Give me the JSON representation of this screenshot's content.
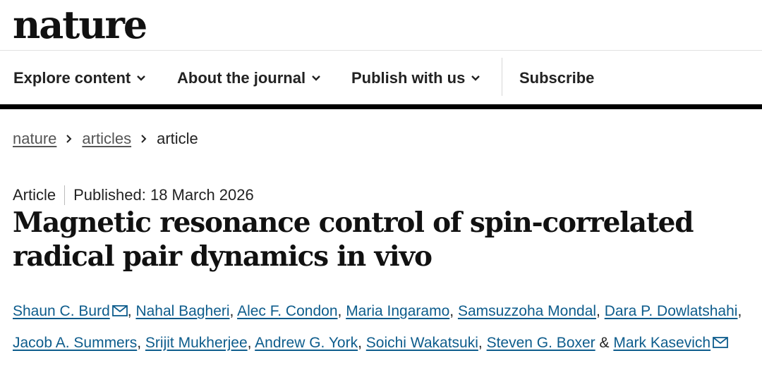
{
  "header": {
    "logo": "nature"
  },
  "nav": {
    "items": [
      {
        "label": "Explore content"
      },
      {
        "label": "About the journal"
      },
      {
        "label": "Publish with us"
      }
    ],
    "subscribe": "Subscribe"
  },
  "breadcrumb": [
    "nature",
    "articles",
    "article"
  ],
  "article": {
    "type": "Article",
    "published": "Published: 18 March 2026",
    "title": "Magnetic resonance control of spin-correlated radical pair dynamics in vivo",
    "authors": [
      "Shaun C. Burd",
      "Nahal Bagheri",
      "Alec F. Condon",
      "Maria Ingaramo",
      "Samsuzzoha Mondal",
      "Dara P. Dowlatshahi",
      "Jacob A. Summers",
      "Srijit Mukherjee",
      "Andrew G. York",
      "Soichi Wakatsuki",
      "Steven G. Boxer",
      "Mark Kasevich"
    ],
    "separator": ",",
    "ampersand": "&"
  },
  "colors": {
    "link": "#0d5c8c",
    "text": "#222222",
    "bar": "#000000"
  },
  "icons": {
    "chevron": "chevron-down-icon",
    "mail": "mail-icon",
    "breadcrumb": "chevron-right-icon"
  }
}
